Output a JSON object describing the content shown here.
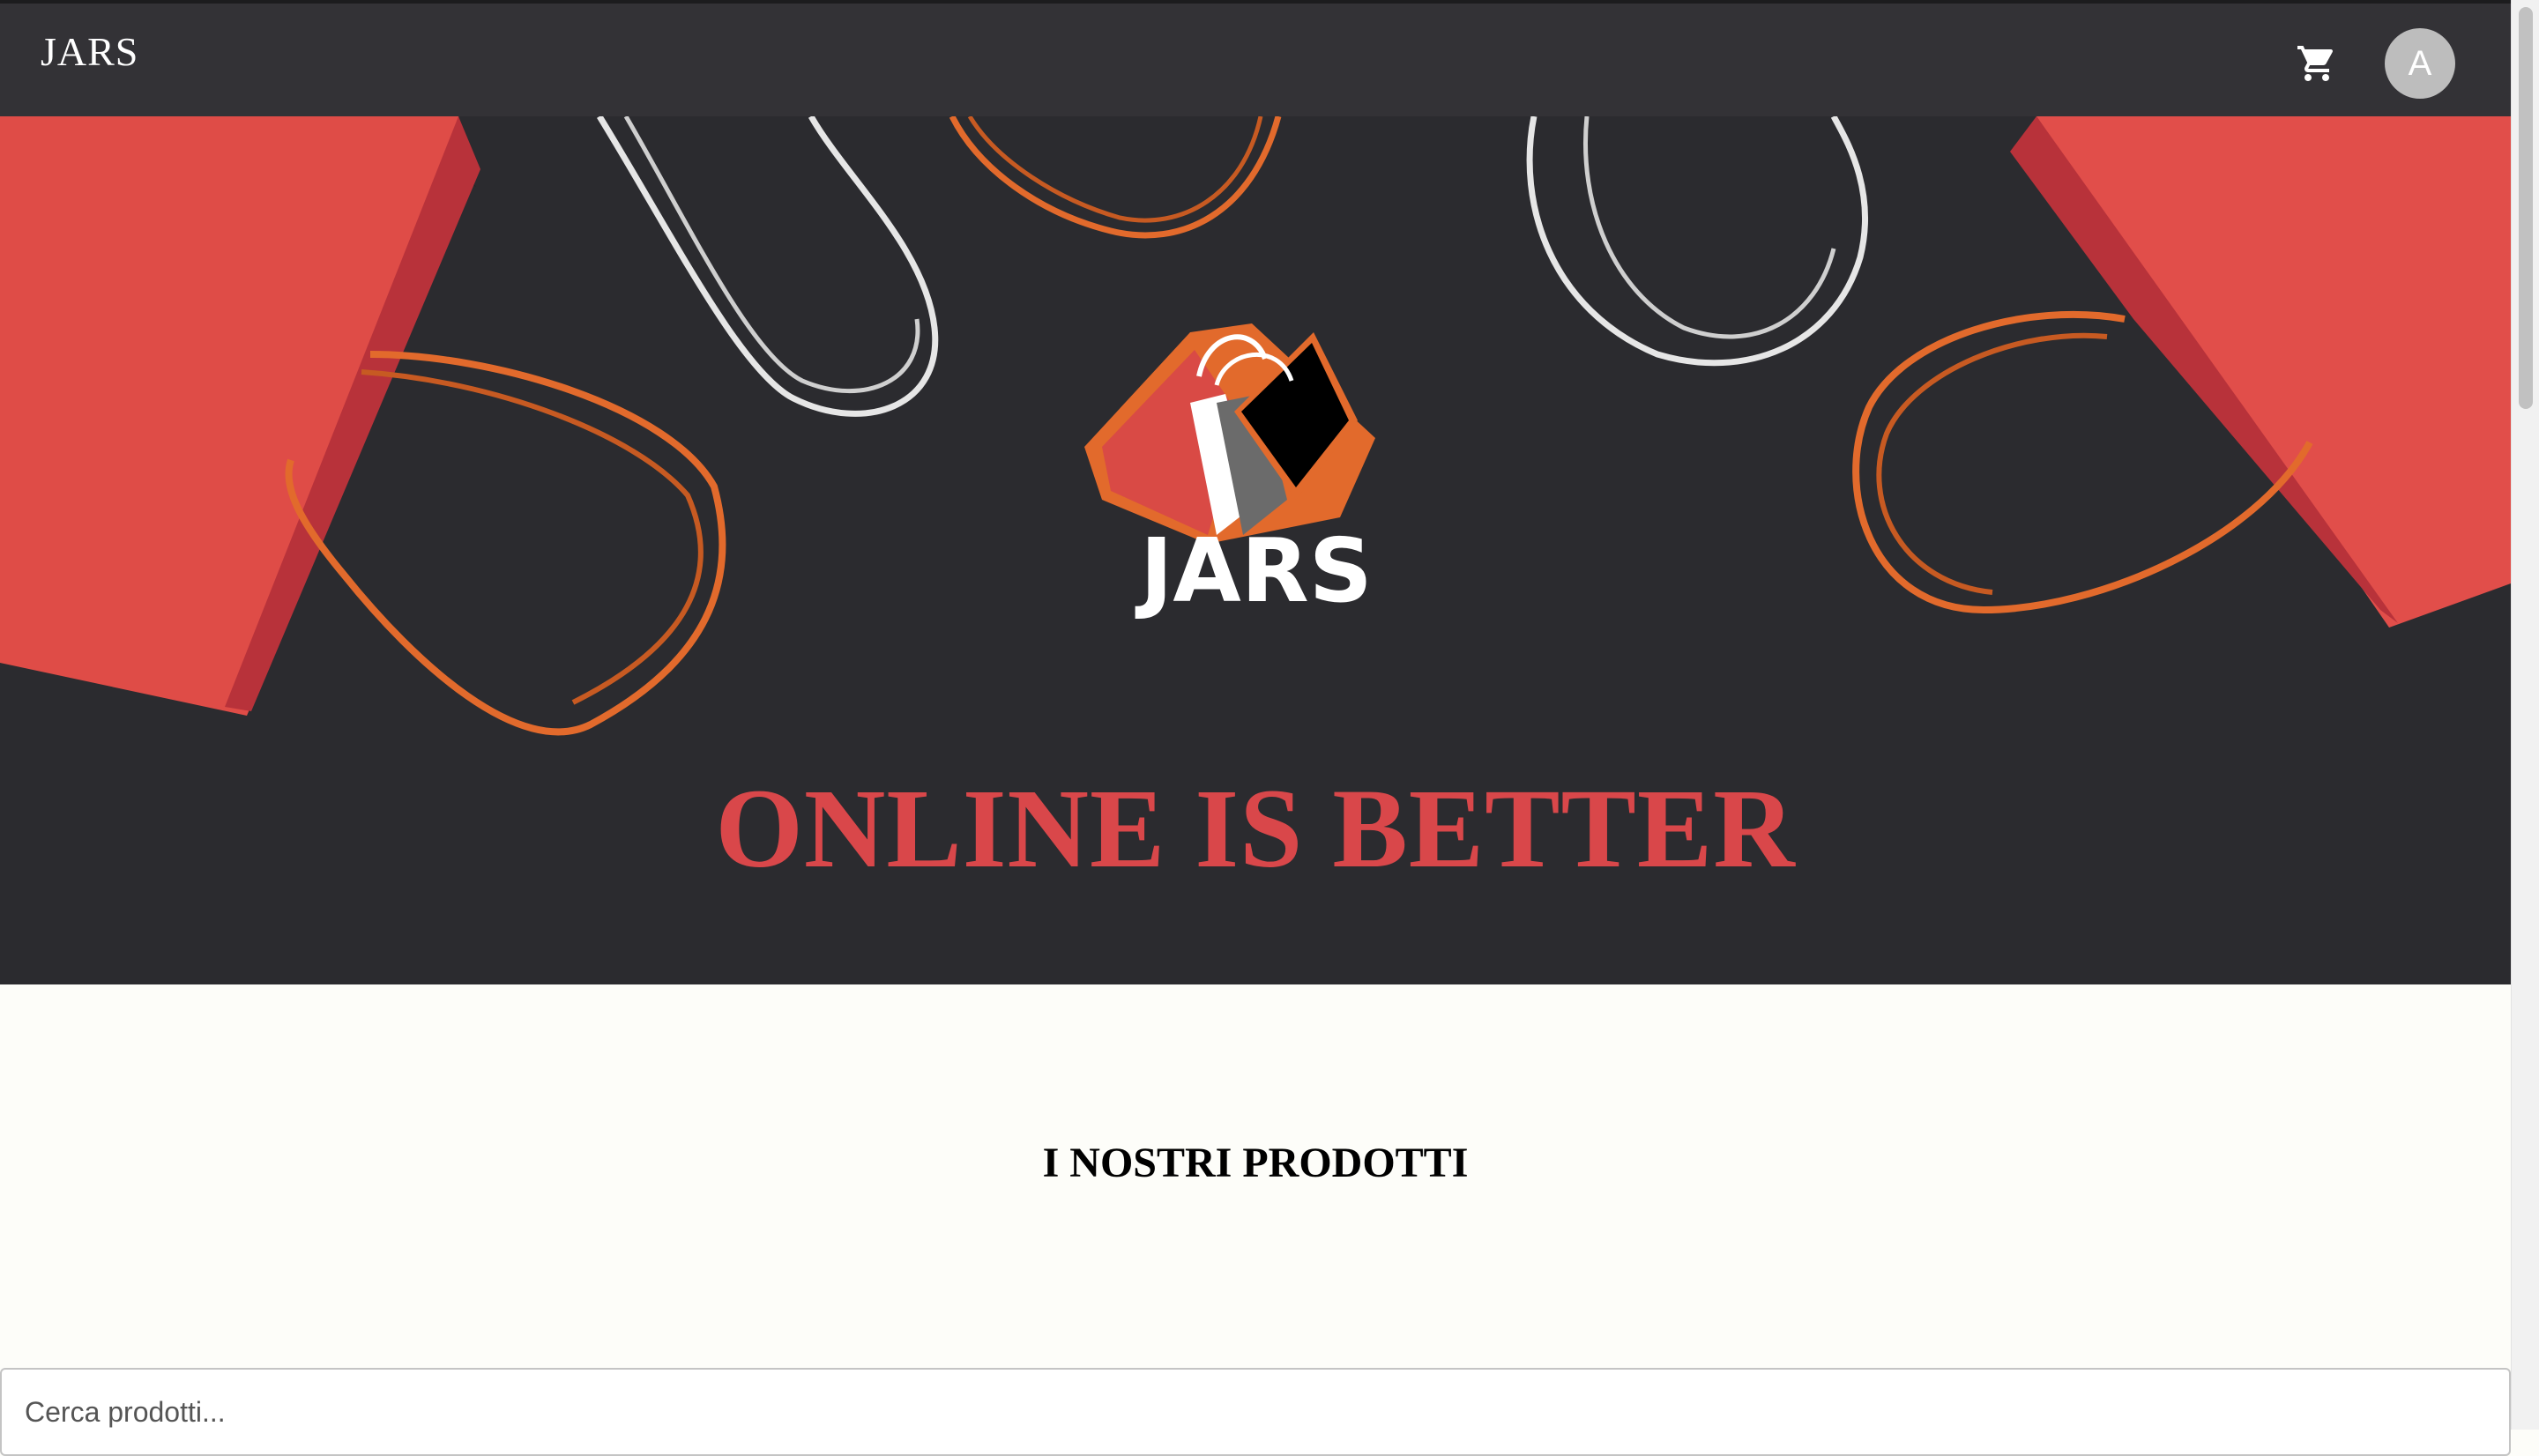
{
  "app": {
    "brand": "JARS"
  },
  "header": {
    "cart_icon": "shopping-cart-icon",
    "avatar_initial": "A"
  },
  "hero": {
    "logo_text": "JARS",
    "slogan": "ONLINE IS BETTER"
  },
  "products": {
    "title": "I NOSTRI PRODOTTI",
    "search_placeholder": "Cerca prodotti..."
  },
  "colors": {
    "appbar": "#333236",
    "hero_background": "#2b2b2f",
    "accent_red": "#d9474a",
    "accent_orange": "#e26a2c",
    "page_background": "#fdfdf9"
  }
}
